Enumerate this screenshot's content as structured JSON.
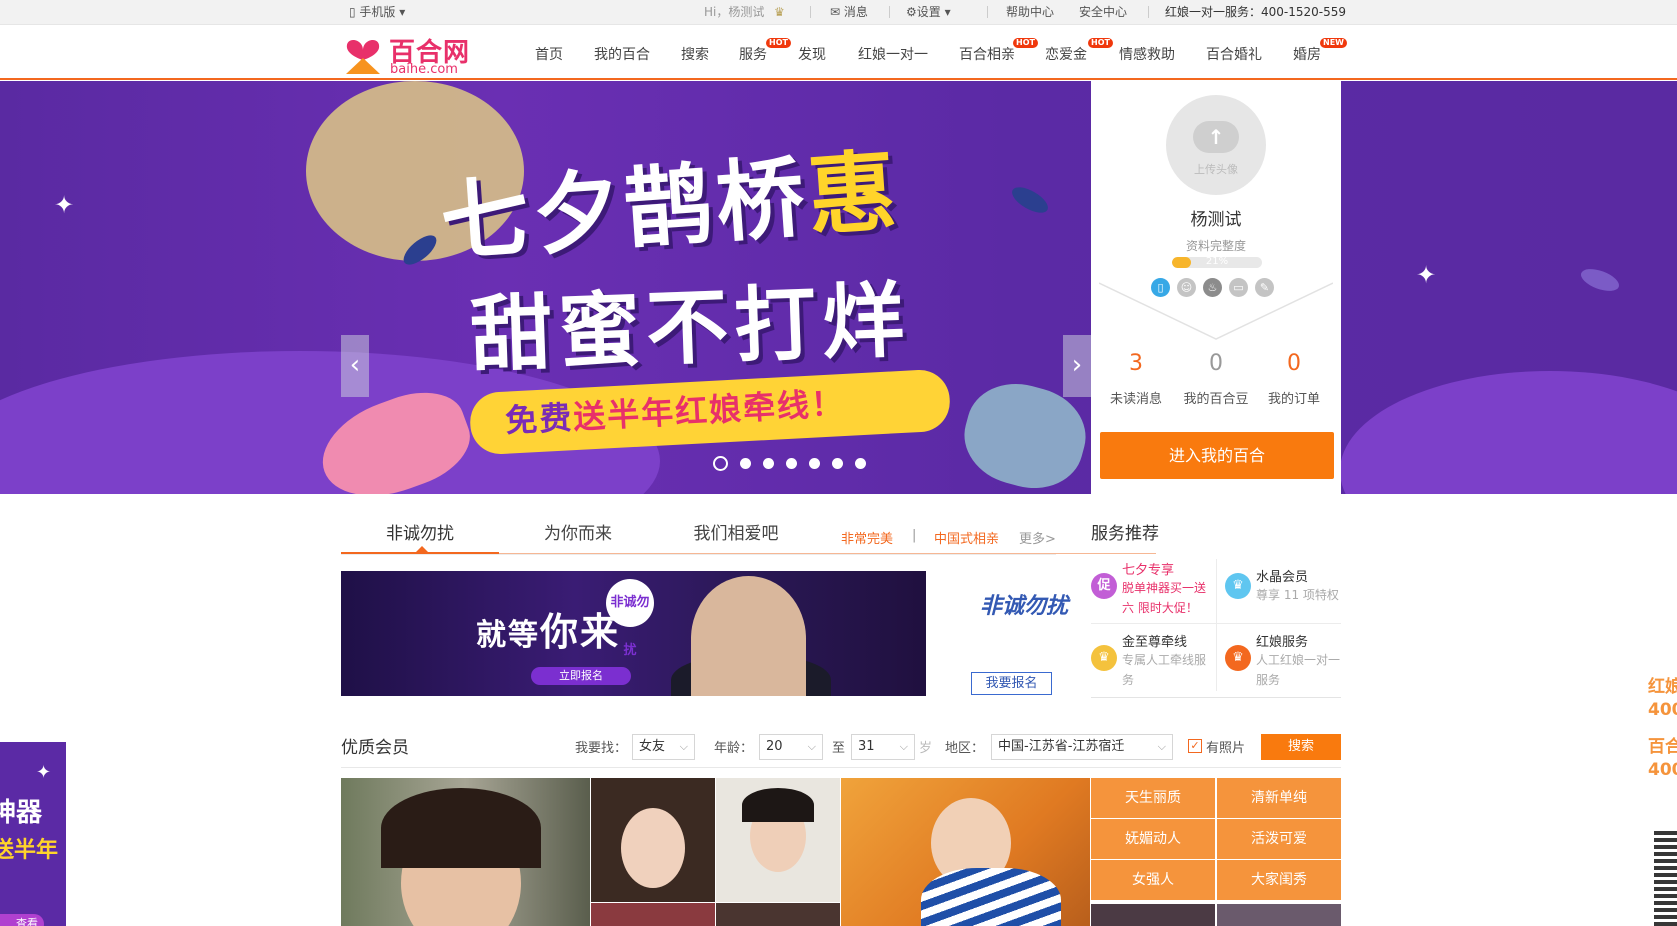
{
  "topbar": {
    "mobile": "手机版",
    "greeting": "Hi，杨测试",
    "messages": "消息",
    "settings": "设置",
    "help": "帮助中心",
    "security": "安全中心",
    "hotline": "红娘一对一服务：400-1520-559"
  },
  "logo": {
    "cn": "百合网",
    "en": "baihe.com"
  },
  "nav": [
    {
      "label": "首页"
    },
    {
      "label": "我的百合"
    },
    {
      "label": "搜索"
    },
    {
      "label": "服务",
      "badge": "HOT"
    },
    {
      "label": "发现"
    },
    {
      "label": "红娘一对一"
    },
    {
      "label": "百合相亲",
      "badge": "HOT"
    },
    {
      "label": "恋爱金",
      "badge": "HOT"
    },
    {
      "label": "情感救助"
    },
    {
      "label": "百合婚礼"
    },
    {
      "label": "婚房",
      "badge": "NEW"
    }
  ],
  "banner": {
    "line1a": "七夕鹊桥",
    "line1b": "惠",
    "line2": "甜蜜不打烊",
    "ribbon_a": "免费",
    "ribbon_b": "送半年红娘牵线！",
    "prev": "‹",
    "next": "›",
    "slides": 7,
    "active_slide": 1
  },
  "user": {
    "avatar_text": "上传头像",
    "name": "杨测试",
    "completeness_label": "资料完整度",
    "completeness": "21%",
    "completeness_value": 0.21,
    "stats": [
      {
        "num": "3",
        "label": "未读消息"
      },
      {
        "num": "0",
        "label": "我的百合豆"
      },
      {
        "num": "0",
        "label": "我的订单"
      }
    ],
    "enter": "进入我的百合"
  },
  "tabs": {
    "items": [
      "非诚勿扰",
      "为你而来",
      "我们相爱吧"
    ],
    "links": [
      "非常完美",
      "|",
      "中国式相亲"
    ],
    "more": "更多>"
  },
  "promo": {
    "headline_a": "就等",
    "headline_b": "你来",
    "button": "立即报名",
    "side_logo": "非诚勿扰",
    "signup": "我要报名"
  },
  "services": {
    "title": "服务推荐",
    "items": [
      {
        "icon": "促",
        "name": "七夕专享",
        "desc": "脱单神器买一送六 限时大促！",
        "color": "#c25ed6"
      },
      {
        "icon": "♛",
        "name": "水晶会员",
        "desc": "尊享 11 项特权",
        "color": "#5fc6f0"
      },
      {
        "icon": "♛",
        "name": "金至尊牵线",
        "desc": "专属人工牵线服务",
        "color": "#f4c23d"
      },
      {
        "icon": "♛",
        "name": "红娘服务",
        "desc": "人工红娘一对一服务",
        "color": "#f3681f"
      }
    ]
  },
  "members": {
    "title": "优质会员",
    "looking_label": "我要找：",
    "looking_value": "女友",
    "age_label": "年龄：",
    "age_from": "20",
    "to": "至",
    "age_to": "31",
    "unit": "岁",
    "region_label": "地区：",
    "region_value": "中国-江苏省-江苏宿迁",
    "photo_label": "有照片",
    "search": "搜索",
    "tags": [
      "天生丽质",
      "清新单纯",
      "妩媚动人",
      "活泼可爱",
      "女强人",
      "大家闺秀"
    ]
  },
  "side": {
    "left_t1": "神器",
    "left_t2": "送半年",
    "left_pill": "查看",
    "right": [
      "红娘",
      "400",
      "百合",
      "400"
    ]
  }
}
